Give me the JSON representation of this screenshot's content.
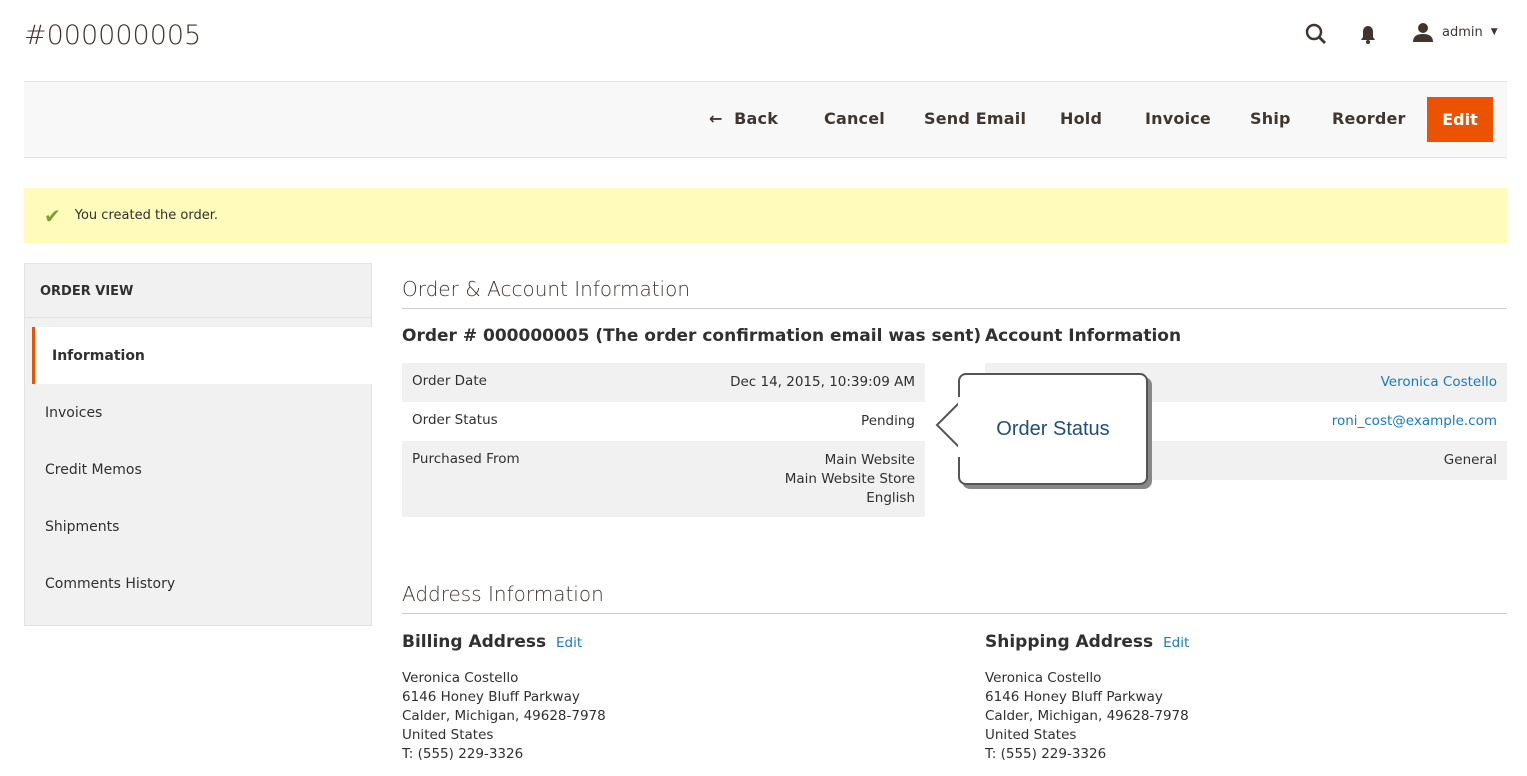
{
  "page_title": "#000000005",
  "header": {
    "user": "admin"
  },
  "toolbar": {
    "back": "Back",
    "cancel": "Cancel",
    "send_email": "Send Email",
    "hold": "Hold",
    "invoice": "Invoice",
    "ship": "Ship",
    "reorder": "Reorder",
    "edit": "Edit"
  },
  "message": "You created the order.",
  "sidebar": {
    "title": "ORDER VIEW",
    "items": [
      {
        "label": "Information"
      },
      {
        "label": "Invoices"
      },
      {
        "label": "Credit Memos"
      },
      {
        "label": "Shipments"
      },
      {
        "label": "Comments History"
      }
    ]
  },
  "order_account": {
    "title": "Order & Account Information",
    "order_heading": "Order # 000000005 (The order confirmation email was sent)",
    "rows": [
      {
        "label": "Order Date",
        "value": "Dec 14, 2015, 10:39:09 AM"
      },
      {
        "label": "Order Status",
        "value": "Pending"
      },
      {
        "label": "Purchased From",
        "value": [
          "Main Website",
          "Main Website Store",
          "English"
        ]
      }
    ],
    "account_heading": "Account Information",
    "account_values": [
      "Veronica Costello",
      "roni_cost@example.com",
      "General"
    ]
  },
  "callout": "Order Status",
  "address": {
    "title": "Address Information",
    "billing": {
      "heading": "Billing Address",
      "edit": "Edit",
      "lines": [
        "Veronica Costello",
        "6146 Honey Bluff Parkway",
        "Calder, Michigan, 49628-7978",
        "United States",
        "T: (555) 229-3326"
      ]
    },
    "shipping": {
      "heading": "Shipping Address",
      "edit": "Edit",
      "lines": [
        "Veronica Costello",
        "6146 Honey Bluff Parkway",
        "Calder, Michigan, 49628-7978",
        "United States",
        "T: (555) 229-3326"
      ]
    }
  },
  "colors": {
    "accent": "#eb5202",
    "link": "#1979c3",
    "message_bg": "#fffbbb",
    "success": "#79a22e"
  }
}
